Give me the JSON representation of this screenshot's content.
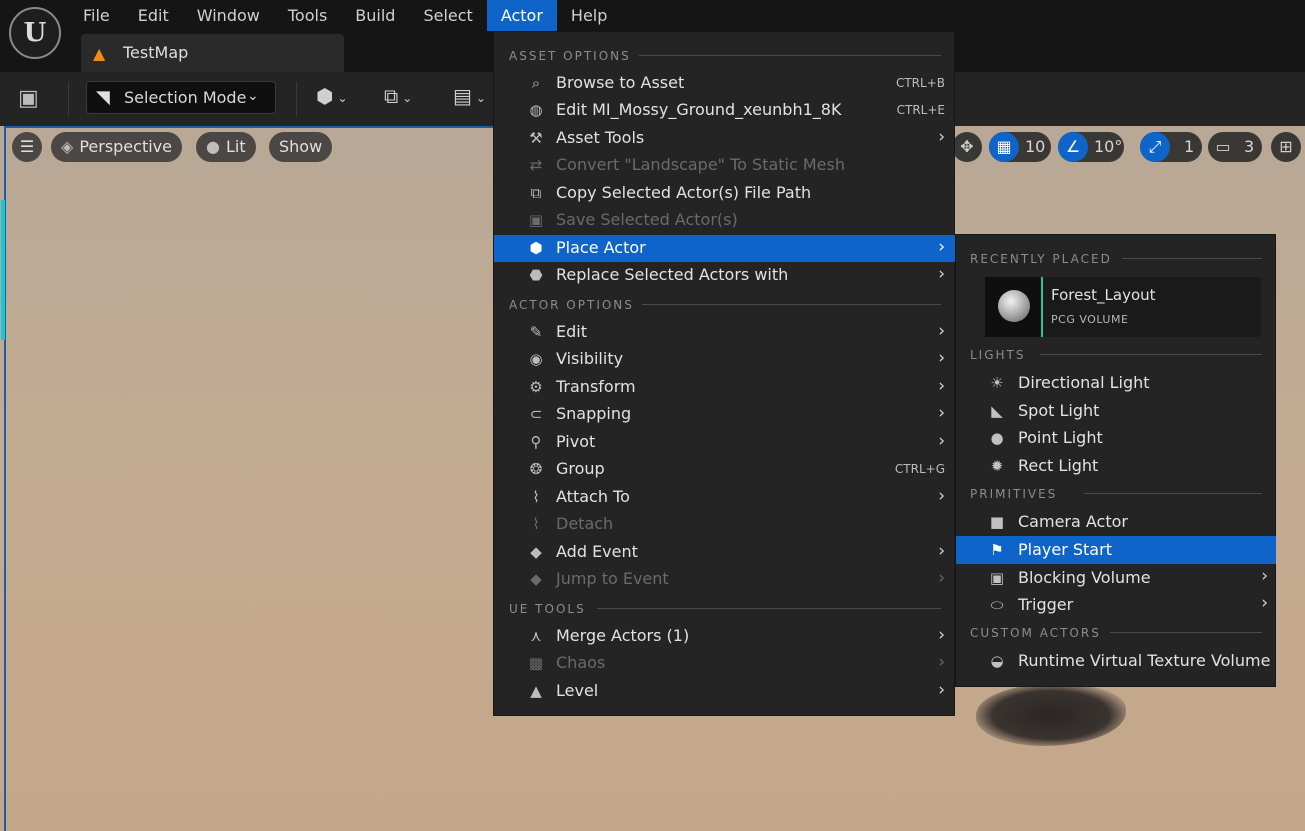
{
  "window": {
    "tab_title": "TestMap"
  },
  "menubar": [
    "File",
    "Edit",
    "Window",
    "Tools",
    "Build",
    "Select",
    "Actor",
    "Help"
  ],
  "toolbar": {
    "mode_label": "Selection Mode"
  },
  "viewport": {
    "menu_label": "Perspective",
    "lit_label": "Lit",
    "show_label": "Show",
    "grid_snap_value": "10",
    "rotation_snap_value": "10°",
    "scale_snap_value": "1",
    "camera_speed_value": "3"
  },
  "actor_menu": {
    "sections": [
      "ASSET OPTIONS",
      "ACTOR OPTIONS",
      "UE TOOLS"
    ],
    "items": [
      {
        "label": "Browse to Asset",
        "shortcut": "CTRL+B",
        "icon": "browse-icon"
      },
      {
        "label": "Edit MI_Mossy_Ground_xeunbh1_8K",
        "shortcut": "CTRL+E",
        "icon": "material-icon"
      },
      {
        "label": "Asset Tools",
        "icon": "wrench-icon"
      },
      {
        "label": "Convert \"Landscape\" To Static Mesh",
        "icon": "convert-icon",
        "disabled": true
      },
      {
        "label": "Copy Selected Actor(s) File Path",
        "icon": "copy-icon"
      },
      {
        "label": "Save Selected Actor(s)",
        "icon": "save-icon",
        "disabled": true
      },
      {
        "label": "Place Actor",
        "icon": "place-actor-icon",
        "highlighted": true
      },
      {
        "label": "Replace Selected Actors with",
        "icon": "replace-icon"
      },
      {
        "label": "Edit",
        "icon": "pencil-icon"
      },
      {
        "label": "Visibility",
        "icon": "eye-icon"
      },
      {
        "label": "Transform",
        "icon": "transform-icon"
      },
      {
        "label": "Snapping",
        "icon": "magnet-icon"
      },
      {
        "label": "Pivot",
        "icon": "pivot-icon"
      },
      {
        "label": "Group",
        "shortcut": "CTRL+G",
        "icon": "group-icon"
      },
      {
        "label": "Attach To",
        "icon": "paperclip-icon"
      },
      {
        "label": "Detach",
        "icon": "detach-icon",
        "disabled": true
      },
      {
        "label": "Add Event",
        "icon": "event-icon"
      },
      {
        "label": "Jump to Event",
        "icon": "jump-icon",
        "disabled": true
      },
      {
        "label": "Merge Actors (1)",
        "icon": "merge-icon"
      },
      {
        "label": "Chaos",
        "icon": "chaos-icon",
        "disabled": true
      },
      {
        "label": "Level",
        "icon": "level-icon"
      }
    ]
  },
  "place_actor_menu": {
    "sections": [
      "RECENTLY PLACED",
      "LIGHTS",
      "PRIMITIVES",
      "CUSTOM ACTORS"
    ],
    "recent": {
      "name": "Forest_Layout",
      "type": "PCG VOLUME"
    },
    "lights": [
      "Directional Light",
      "Spot Light",
      "Point Light",
      "Rect Light"
    ],
    "primitives": [
      "Camera Actor",
      "Player Start",
      "Blocking Volume",
      "Trigger"
    ],
    "custom": [
      "Runtime Virtual Texture Volume"
    ]
  },
  "colors": {
    "accent": "#0e64c8",
    "menu_bg": "#242424",
    "disabled_text": "#6a6a6a",
    "pcg_accent": "#22c7a0"
  }
}
